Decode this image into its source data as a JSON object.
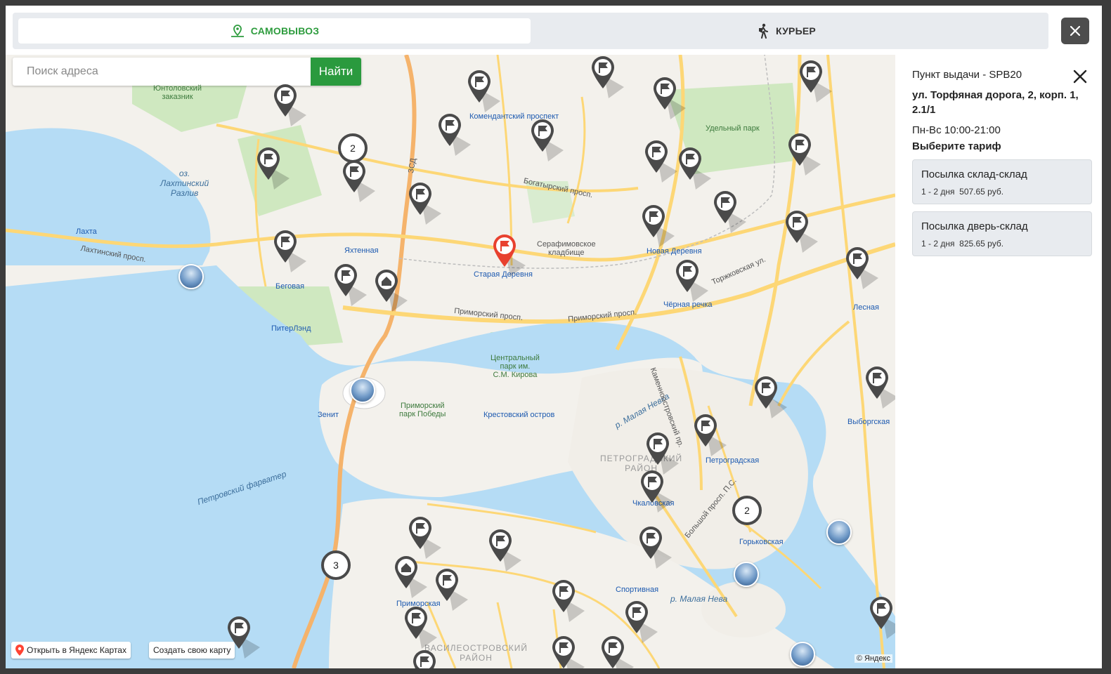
{
  "tabs": [
    {
      "label": "САМОВЫВОЗ",
      "active": true
    },
    {
      "label": "КУРЬЕР",
      "active": false
    }
  ],
  "search": {
    "placeholder": "Поиск адреса",
    "button": "Найти"
  },
  "map": {
    "clusters": [
      "2",
      "2",
      "3"
    ],
    "labels": {
      "reserve": "Юнтоловский\nзаказник",
      "lake": "оз.\nЛахтинский\nРазлив",
      "lakhta": "Лахта",
      "lakhtinsky": "Лахтинский просп.",
      "begovaya": "Беговая",
      "yakhtennaya": "Яхтенная",
      "piterlend": "ПитерЛэнд",
      "komendantsky": "Комендантский проспект",
      "staraya": "Старая Деревня",
      "cemetery": "Серафимовское\nкладбище",
      "novaya": "Новая Деревня",
      "chernaya": "Чёрная речка",
      "lesnaya": "Лесная",
      "udelny": "Удельный парк",
      "kirov_park": "Центральный\nпарк им.\nС.М. Кирова",
      "victory_park": "Приморский\nпарк Победы",
      "krestovsky": "Крестовский остров",
      "zenit": "Зенит",
      "petrogradsky": "ПЕТРОГРАДСКИЙ\nРАЙОН",
      "petrogradskaya": "Петроградская",
      "chkalovskaya": "Чкаловская",
      "gorkovskaya": "Горьковская",
      "sportivnaya": "Спортивная",
      "vyborgskaya": "Выборгская",
      "primorskaya": "Приморская",
      "vasileostrovsky": "ВАСИЛЕОСТРОВСКИЙ\nРАЙОН",
      "fairway": "Петровский фарватер",
      "malaya_nevka": "р. Малая Невка",
      "malaya_neva": "р. Малая Нева",
      "primorsky_prosp": "Приморский просп.",
      "primorsky_prosp2": "Приморский просп.",
      "bogatyrsky": "Богатырский просп.",
      "torzhkovskaya": "Торжковская ул.",
      "zsd": "ЗСД",
      "kamennoostrovsky": "Каменноостровский пр.",
      "bolshoy": "Большой просп. П.С."
    },
    "open_yandex": "Открыть в Яндекс Картах",
    "create_map": "Создать свою карту",
    "copyright": "© Яндекс"
  },
  "panel": {
    "title": "Пункт выдачи - SPB20",
    "address": "ул. Торфяная дорога, 2, корп. 1, 2.1/1",
    "hours": "Пн-Вс 10:00-21:00",
    "tariff_header": "Выберите тариф",
    "tariffs": [
      {
        "name": "Посылка склад-склад",
        "price": "1 - 2 дня  507.65 руб."
      },
      {
        "name": "Посылка дверь-склад",
        "price": "1 - 2 дня  825.65 руб."
      }
    ]
  },
  "colors": {
    "accent": "#2e9c3e",
    "button": "#2a9a3e",
    "selected_pin": "#e8412f",
    "pin": "#4a4a4a",
    "water": "#b5dcf5",
    "park": "#cfe8c0",
    "road": "#fdd776"
  }
}
